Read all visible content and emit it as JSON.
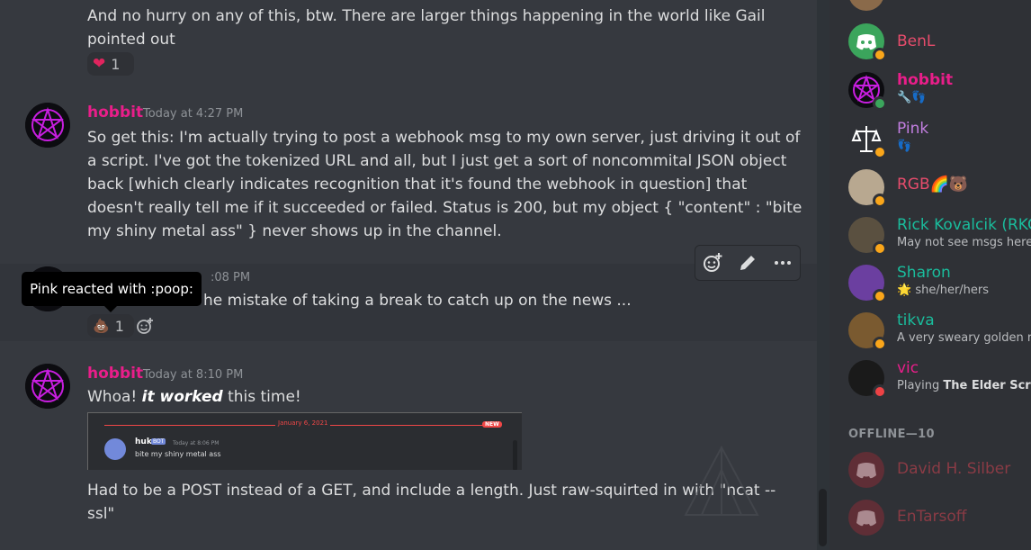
{
  "messages": {
    "m0": {
      "line1": "And no hurry on any of this, btw.  There are larger things happening in the world like Gail",
      "line2": "pointed out",
      "reaction_emoji": "heart",
      "reaction_count": "1"
    },
    "m1": {
      "author": "hobbit",
      "timestamp": "Today at 4:27 PM",
      "lines": [
        "So get this: I'm actually trying to post a webhook msg to my own server, just driving it out of",
        "a script.  I've got the tokenized URL and all, but I just get a sort of noncommital JSON object",
        "back [which clearly indicates recognition that it's found the webhook in question] that",
        "doesn't really tell me if it succeeded or failed.  Status is 200, but my object { \"content\" : \"bite",
        "my shiny metal ass\" } never shows up in the channel."
      ]
    },
    "m2": {
      "timestamp_partial": ":08 PM",
      "text_partial": "he mistake of taking a break to catch up on the news ...",
      "reaction_emoji": "poop",
      "reaction_count": "1"
    },
    "m3": {
      "author": "hobbit",
      "timestamp": "Today at 8:10 PM",
      "line1_a": "Whoa!  ",
      "line1_b": "it worked",
      "line1_c": " this time!",
      "after1": "Had to be a POST instead of a GET, and include a length.  Just raw-squirted in with \"ncat --",
      "after2": "ssl\""
    }
  },
  "tooltip": "Pink reacted with :poop:",
  "embed": {
    "date": "January 6, 2021",
    "new_badge": "NEW",
    "author": "huk",
    "bot_tag": "BOT",
    "time": "Today at 8:06 PM",
    "body": "bite my shiny metal ass"
  },
  "members": [
    {
      "name": "BenL",
      "sub": "",
      "color": "#e74c6c",
      "avatar": "discord-logo-icon",
      "status": "idle"
    },
    {
      "name": "hobbit",
      "sub": "🔧👣",
      "color": "#e91e8a",
      "avatar": "pentagram-icon",
      "status": "online"
    },
    {
      "name": "Pink",
      "sub": "👣",
      "color": "#c27ee0",
      "avatar": "scales-icon",
      "status": "idle"
    },
    {
      "name": "RGB🌈🐻",
      "sub": "",
      "color": "#e74c6c",
      "avatar": "photo-avatar",
      "status": "idle"
    },
    {
      "name": "Rick Kovalcik (RKC",
      "sub": "May not see msgs here o",
      "color": "#1abc9c",
      "avatar": "photo-avatar",
      "status": "idle"
    },
    {
      "name": "Sharon",
      "sub": "🌟 she/her/hers",
      "color": "#1abc9c",
      "avatar": "photo-avatar",
      "status": "idle"
    },
    {
      "name": "tikva",
      "sub": "A very sweary golden ret",
      "color": "#1abc9c",
      "avatar": "photo-avatar",
      "status": "idle"
    },
    {
      "name": "vic",
      "sub_a": "Playing ",
      "sub_b": "The Elder Scrolls",
      "color": "#e91e8a",
      "avatar": "cat-avatar",
      "status": "dnd"
    }
  ],
  "offline_header": "OFFLINE—10",
  "offline_members": [
    {
      "name": "David H. Silber",
      "color": "#8a3b45"
    },
    {
      "name": "EnTarsoff",
      "color": "#8a3b45"
    }
  ],
  "colors": {
    "chat_bg": "#36393f",
    "sidebar_bg": "#2f3136",
    "accent_magenta": "#e91e8a"
  }
}
